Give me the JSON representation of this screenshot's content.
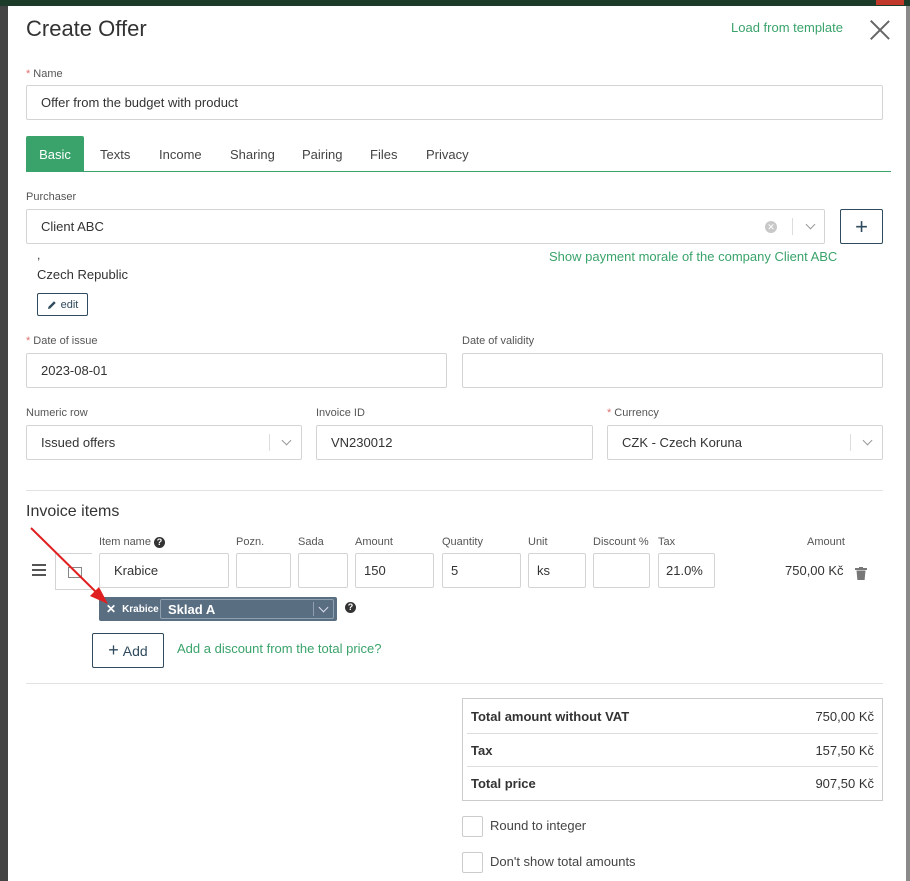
{
  "modal": {
    "title": "Create Offer",
    "load_template": "Load from template"
  },
  "name_field": {
    "label": "Name",
    "value": "Offer from the budget with product"
  },
  "tabs": [
    {
      "label": "Basic",
      "active": true
    },
    {
      "label": "Texts"
    },
    {
      "label": "Income"
    },
    {
      "label": "Sharing"
    },
    {
      "label": "Pairing"
    },
    {
      "label": "Files"
    },
    {
      "label": "Privacy"
    }
  ],
  "purchaser": {
    "label": "Purchaser",
    "value": "Client ABC",
    "address_line1": ",",
    "address_line2": "Czech Republic",
    "edit_label": "edit",
    "payment_morale_link": "Show payment morale of the company Client ABC",
    "add_symbol": "+"
  },
  "dates": {
    "issue_label": "Date of issue",
    "issue_value": "2023-08-01",
    "validity_label": "Date of validity",
    "validity_value": ""
  },
  "numbering": {
    "numeric_row_label": "Numeric row",
    "numeric_row_value": "Issued offers",
    "invoice_id_label": "Invoice ID",
    "invoice_id_value": "VN230012",
    "currency_label": "Currency",
    "currency_value": "CZK - Czech Koruna"
  },
  "items": {
    "section_title": "Invoice items",
    "headers": {
      "item_name": "Item name",
      "pozn": "Pozn.",
      "sada": "Sada",
      "amount": "Amount",
      "quantity": "Quantity",
      "unit": "Unit",
      "discount": "Discount %",
      "tax": "Tax",
      "line_amount": "Amount"
    },
    "row": {
      "item_name": "Krabice",
      "pozn": "",
      "sada": "",
      "amount": "150",
      "quantity": "5",
      "unit": "ks",
      "discount": "",
      "tax": "21.0%",
      "line_amount": "750,00 Kč"
    },
    "stock": {
      "item": "Krabice",
      "warehouse": "Sklad A"
    },
    "add_label": "Add",
    "discount_link": "Add a discount from the total price?"
  },
  "totals": {
    "without_vat_label": "Total amount without VAT",
    "without_vat_value": "750,00 Kč",
    "tax_label": "Tax",
    "tax_value": "157,50 Kč",
    "total_label": "Total price",
    "total_value": "907,50 Kč"
  },
  "options": {
    "round_label": "Round to integer",
    "hide_totals_label": "Don't show total amounts"
  },
  "colors": {
    "accent": "#3aa36b",
    "dark_button": "#2f4b5d",
    "stock_tag": "#5a6e82",
    "annotation_arrow": "#e02020"
  }
}
